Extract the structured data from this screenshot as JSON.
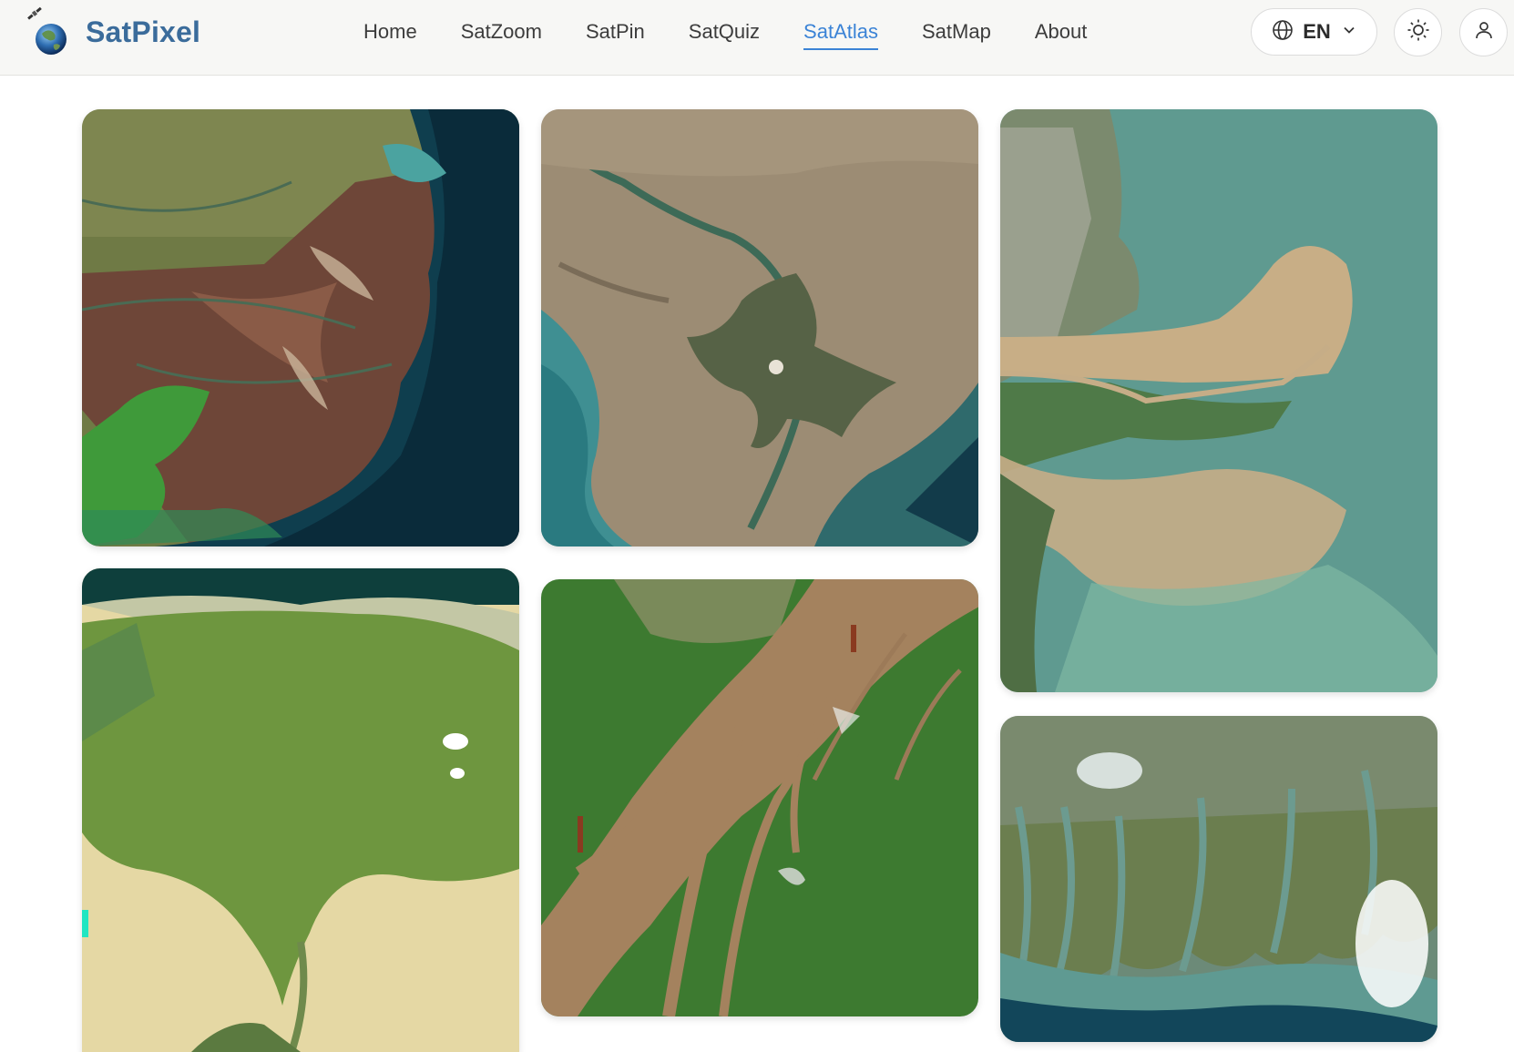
{
  "brand": {
    "name": "SatPixel",
    "logo_icon": "satellite-globe-icon"
  },
  "nav": {
    "items": [
      {
        "label": "Home"
      },
      {
        "label": "SatZoom"
      },
      {
        "label": "SatPin"
      },
      {
        "label": "SatQuiz"
      },
      {
        "label": "SatAtlas",
        "active": true
      },
      {
        "label": "SatMap"
      },
      {
        "label": "About"
      }
    ]
  },
  "header_actions": {
    "language": {
      "code": "EN",
      "icon": "globe-icon",
      "caret": "chevron-down-icon"
    },
    "theme_icon": "sun-icon",
    "account_icon": "user-icon"
  },
  "gallery": {
    "cards": [
      {
        "id": "delta-1",
        "dominant_color": "#6d4a3a"
      },
      {
        "id": "delta-2",
        "dominant_color": "#9a8a72"
      },
      {
        "id": "delta-3",
        "dominant_color": "#78a093"
      },
      {
        "id": "delta-4",
        "dominant_color": "#5f8a3c"
      },
      {
        "id": "delta-5",
        "dominant_color": "#3e7a2f"
      },
      {
        "id": "delta-6",
        "dominant_color": "#6c8a78"
      }
    ]
  },
  "colors": {
    "accent": "#3b83d6",
    "brand_text": "#3b6c9b",
    "header_bg": "#f7f7f5"
  }
}
